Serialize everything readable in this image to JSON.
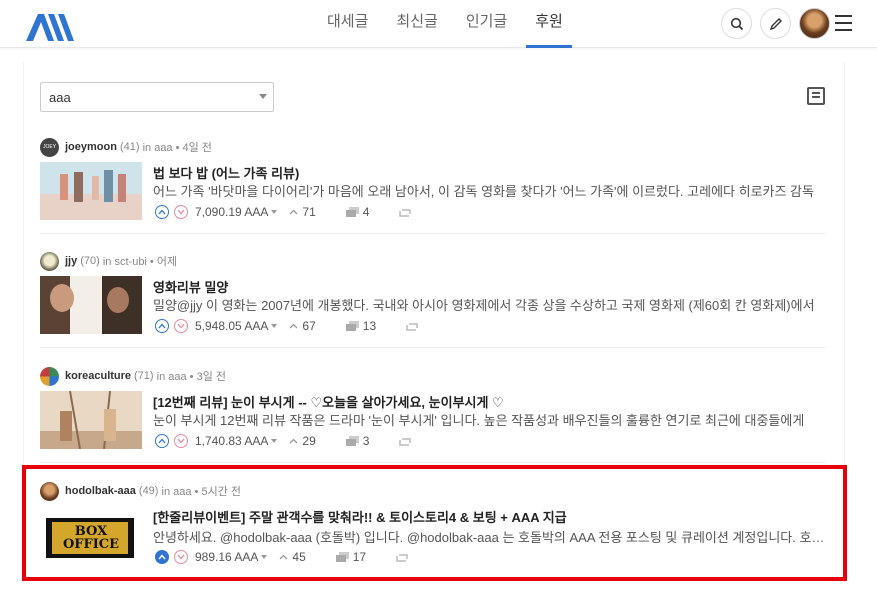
{
  "nav": {
    "items": [
      {
        "label": "대세글",
        "active": false
      },
      {
        "label": "최신글",
        "active": false
      },
      {
        "label": "인기글",
        "active": false
      },
      {
        "label": "후원",
        "active": true
      }
    ]
  },
  "filter": {
    "selected": "aaa"
  },
  "colors": {
    "accent": "#2f74d0",
    "downvote": "#e88a9a",
    "highlight": "#e5000a"
  },
  "posts": [
    {
      "author": "joeymoon",
      "rep": "(41)",
      "meta": "in aaa • 4일 전",
      "avatar_text": "JOEY",
      "title": "법 보다 밥 (어느 가족 리뷰)",
      "desc": "어느 가족 '바닷마을 다이어리'가 마음에 오래 남아서, 이 감독 영화를 찾다가 '어느 가족'에 이르렀다. 고레에다 히로카즈 감독",
      "payout": "7,090.19 AAA",
      "votes": "71",
      "comments": "4"
    },
    {
      "author": "jjy",
      "rep": "(70)",
      "meta": "in sct-ubi • 어제",
      "title": "영화리뷰 밀양",
      "desc": "밀양@jjy 이 영화는 2007년에 개봉했다. 국내와 아시아 영화제에서 각종 상을 수상하고 국제 영화제 (제60회 칸 영화제)에서",
      "payout": "5,948.05 AAA",
      "votes": "67",
      "comments": "13"
    },
    {
      "author": "koreaculture",
      "rep": "(71)",
      "meta": "in aaa • 3일 전",
      "title": "[12번째 리뷰] 눈이 부시게 -- ♡오늘을 살아가세요, 눈이부시게 ♡",
      "desc": "눈이 부시게 12번째 리뷰 작품은 드라마 '눈이 부시게' 입니다. 높은 작품성과 배우진들의 훌륭한 연기로 최근에 대중들에게",
      "payout": "1,740.83 AAA",
      "votes": "29",
      "comments": "3"
    },
    {
      "author": "hodolbak-aaa",
      "rep": "(49)",
      "meta": "in aaa • 5시간 전",
      "thumb_text": "BOX OFFICE",
      "title": "[한줄리뷰이벤트] 주말 관객수를 맞춰라!! & 토이스토리4 & 보팅 + AAA 지급",
      "desc": "안녕하세요. @hodolbak-aaa (호돌박) 입니다. @hodolbak-aaa 는 호돌박의 AAA 전용 포스팅 및 큐레이션 계정입니다. 호돌박이",
      "payout": "989.16 AAA",
      "votes": "45",
      "comments": "17"
    }
  ]
}
